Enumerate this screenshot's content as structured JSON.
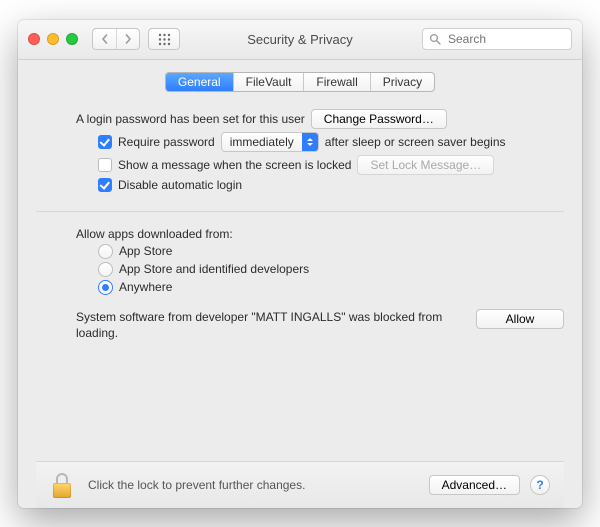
{
  "window": {
    "title": "Security & Privacy"
  },
  "search": {
    "placeholder": "Search"
  },
  "tabs": [
    {
      "label": "General",
      "selected": true
    },
    {
      "label": "FileVault",
      "selected": false
    },
    {
      "label": "Firewall",
      "selected": false
    },
    {
      "label": "Privacy",
      "selected": false
    }
  ],
  "login": {
    "password_set_text": "A login password has been set for this user",
    "change_password_label": "Change Password…",
    "require_password": {
      "checked": true,
      "prefix": "Require password",
      "popup_value": "immediately",
      "suffix": "after sleep or screen saver begins"
    },
    "show_message": {
      "checked": false,
      "label": "Show a message when the screen is locked",
      "button_label": "Set Lock Message…",
      "button_enabled": false
    },
    "disable_auto_login": {
      "checked": true,
      "label": "Disable automatic login"
    }
  },
  "downloads": {
    "heading": "Allow apps downloaded from:",
    "options": [
      {
        "label": "App Store",
        "selected": false
      },
      {
        "label": "App Store and identified developers",
        "selected": false
      },
      {
        "label": "Anywhere",
        "selected": true
      }
    ]
  },
  "blocked": {
    "message": "System software from developer \"MATT INGALLS\" was blocked from loading.",
    "allow_label": "Allow"
  },
  "footer": {
    "lock_text": "Click the lock to prevent further changes.",
    "advanced_label": "Advanced…",
    "help_label": "?"
  }
}
